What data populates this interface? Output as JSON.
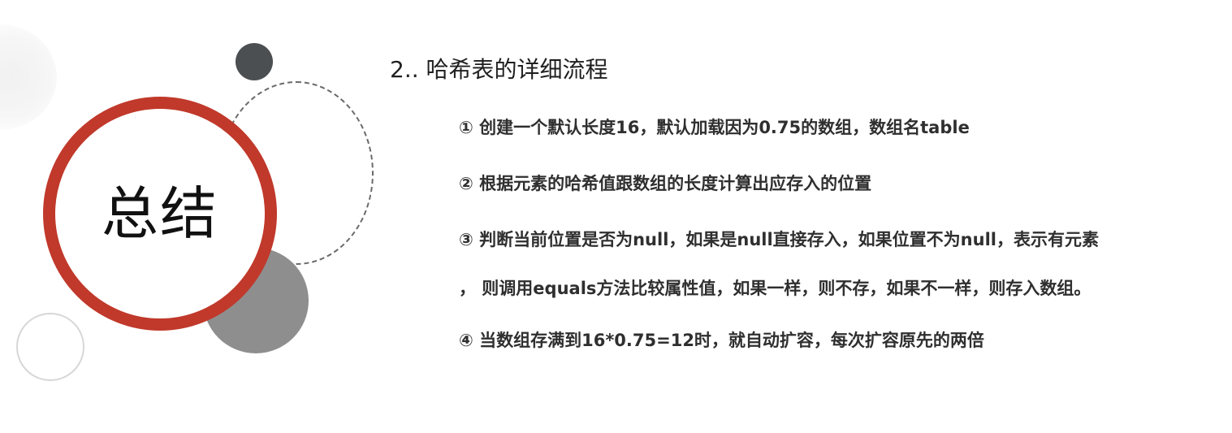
{
  "badge": {
    "label": "总结",
    "ring_color": "#c0392b"
  },
  "heading": "2.. 哈希表的详细流程",
  "steps": [
    "① 创建一个默认长度16，默认加载因为0.75的数组，数组名table",
    "② 根据元素的哈希值跟数组的长度计算出应存入的位置",
    "③ 判断当前位置是否为null，如果是null直接存入，如果位置不为null，表示有元素",
    "，  则调用equals方法比较属性值，如果一样，则不存，如果不一样，则存入数组。",
    "④ 当数组存满到16*0.75=12时，就自动扩容，每次扩容原先的两倍"
  ],
  "colors": {
    "accent": "#c0392b",
    "dark_dot": "#4b4f51",
    "gray_disc": "#8e8e8e"
  }
}
